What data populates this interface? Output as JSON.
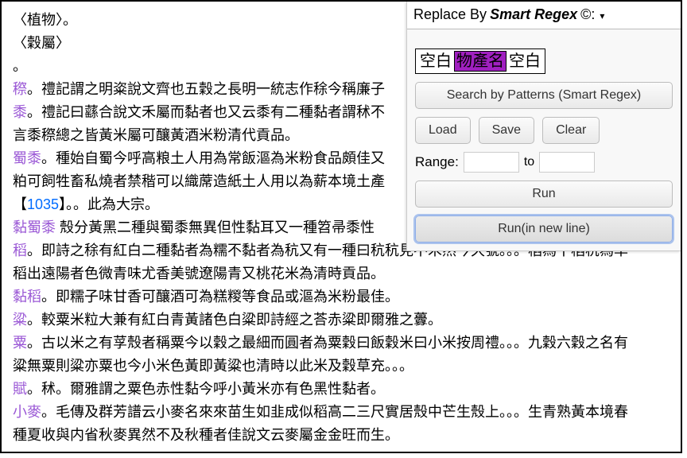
{
  "text": {
    "l1": "〈植物〉。",
    "l2": "〈穀屬〉",
    "l3": "。",
    "l4_head": "穄",
    "l4": "。禮記謂之明粢說文齊也五穀之長明一統志作稌今稱廉子",
    "l5_head": "黍",
    "l5_a": "。禮記曰蘨合說文禾屬而黏者也又云黍有二種黏者謂秫不",
    "l5_b": "言黍穄總之皆黃米屬可釀黃酒米粉清代貢品。",
    "l6_head": "蜀黍",
    "l6_a": "。種始自蜀今呼高粮土人用為常飯漚為米粉食品頗佳又",
    "l6_b": "粕可飼牲畜私燒者禁稭可以織蓆造紙土人用以為薪本境土產",
    "l7_a": "【",
    "l7_num": "1035",
    "l7_b": "】。。此為大宗。",
    "l8_head": "黏蜀黍",
    "l8_a": " 殼分黃黑二種與蜀黍無異但性黏耳又一種笤帚黍性",
    "l9_head": "稻",
    "l9_a": "。即詩之稌有紅白二種黏者為糯不黏者為秔又有一種曰秔",
    "l9_tail": "秔見不禾然今久號。。。稻為干稻秔為旱",
    "l9_b": "稻出遠陽者色微青味尤香美號遼陽青又桃花米為清時貢品。",
    "l10_head": "黏稻",
    "l10": "。即糯子味甘香可釀酒可為糕糉等食品或漚為米粉最佳。",
    "l11_head": "粱",
    "l11": "。較粟米粒大兼有紅白青黃諸色白粱即詩經之荅赤粱即爾雅之虋。",
    "l12_head": "粟",
    "l12_a": "。古以米之有莩殼者稱粟今以穀之最細而圓者為粟穀曰飯穀米曰小米按周禮。。。九穀六穀之名有",
    "l12_b": "粱無粟則粱亦粟也今小米色黃即黃粱也清時以此米及穀草充。。。",
    "l13_head": "賦",
    "l13": "。秫。爾雅謂之粟色赤性黏今呼小黃米亦有色黑性黏者。",
    "l14_head": "小麥",
    "l14_a": "。毛傳及群芳譜云小麥名來來苗生如韭成似稻高二三尺實居殼中芒生殼上。。。生青熟黃本境春",
    "l14_b": "種夏收與内省秋麥異然不及秋種者佳說文云麥屬金金旺而生。"
  },
  "panel": {
    "title_a": "Replace By ",
    "title_b": "Smart Regex",
    "title_c": "©:",
    "dropdown_icon": "▾",
    "pattern": [
      "空白",
      "物產名",
      "空白"
    ],
    "search_btn": "Search by Patterns (Smart Regex)",
    "load_btn": "Load",
    "save_btn": "Save",
    "clear_btn": "Clear",
    "range_label": "Range:",
    "range_to": "to",
    "range_from_val": "",
    "range_to_val": "",
    "run_btn": "Run",
    "run_newline_btn": "Run(in new line)"
  }
}
